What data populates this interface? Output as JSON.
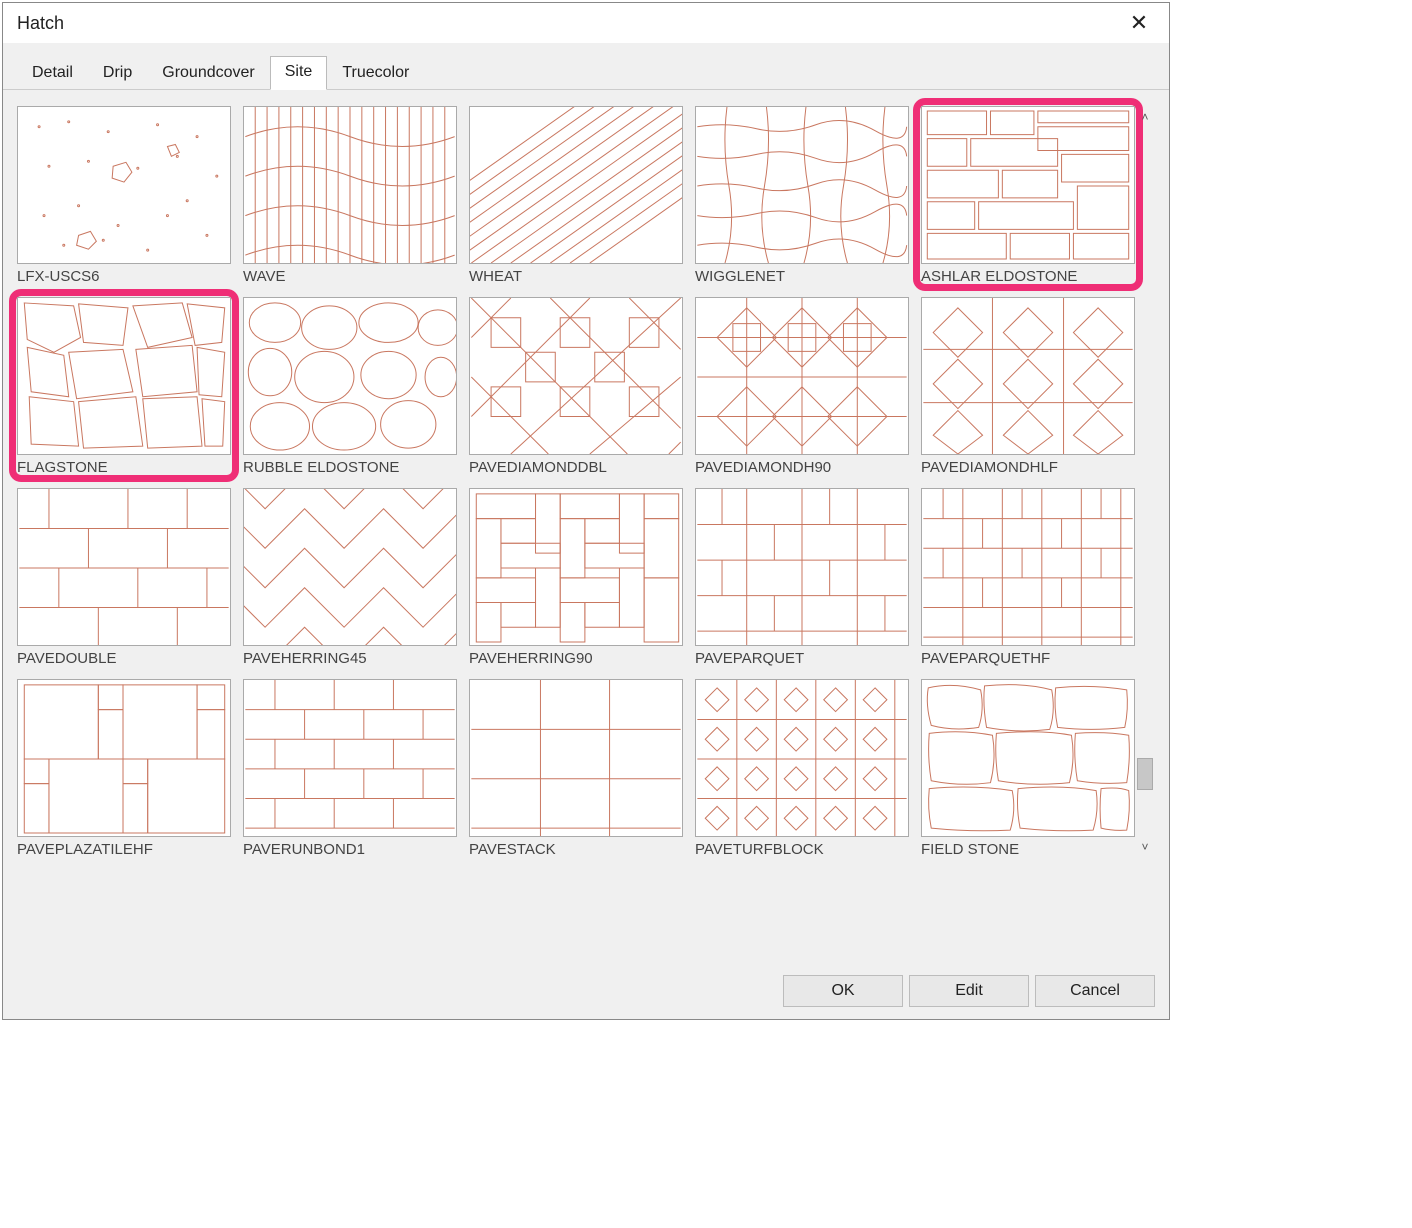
{
  "title": "Hatch",
  "tabs": [
    {
      "label": "Detail",
      "active": false
    },
    {
      "label": "Drip",
      "active": false
    },
    {
      "label": "Groundcover",
      "active": false
    },
    {
      "label": "Site",
      "active": true
    },
    {
      "label": "Truecolor",
      "active": false
    }
  ],
  "buttons": {
    "ok": "OK",
    "edit": "Edit",
    "cancel": "Cancel"
  },
  "swatches": [
    {
      "name": "LFX-USCS6",
      "highlighted": false
    },
    {
      "name": "WAVE",
      "highlighted": false
    },
    {
      "name": "WHEAT",
      "highlighted": false
    },
    {
      "name": "WIGGLENET",
      "highlighted": false
    },
    {
      "name": "ASHLAR ELDOSTONE",
      "highlighted": true
    },
    {
      "name": "FLAGSTONE",
      "highlighted": true
    },
    {
      "name": "RUBBLE ELDOSTONE",
      "highlighted": false
    },
    {
      "name": "PAVEDIAMONDDBL",
      "highlighted": false
    },
    {
      "name": "PAVEDIAMONDH90",
      "highlighted": false
    },
    {
      "name": "PAVEDIAMONDHLF",
      "highlighted": false
    },
    {
      "name": "PAVEDOUBLE",
      "highlighted": false
    },
    {
      "name": "PAVEHERRING45",
      "highlighted": false
    },
    {
      "name": "PAVEHERRING90",
      "highlighted": false
    },
    {
      "name": "PAVEPARQUET",
      "highlighted": false
    },
    {
      "name": "PAVEPARQUETHF",
      "highlighted": false
    },
    {
      "name": "PAVEPLAZATILEHF",
      "highlighted": false
    },
    {
      "name": "PAVERUNBOND1",
      "highlighted": false
    },
    {
      "name": "PAVESTACK",
      "highlighted": false
    },
    {
      "name": "PAVETURFBLOCK",
      "highlighted": false
    },
    {
      "name": "FIELD STONE",
      "highlighted": false
    }
  ],
  "colors": {
    "hatch_stroke": "#c97760",
    "highlight": "#ef2e76"
  }
}
